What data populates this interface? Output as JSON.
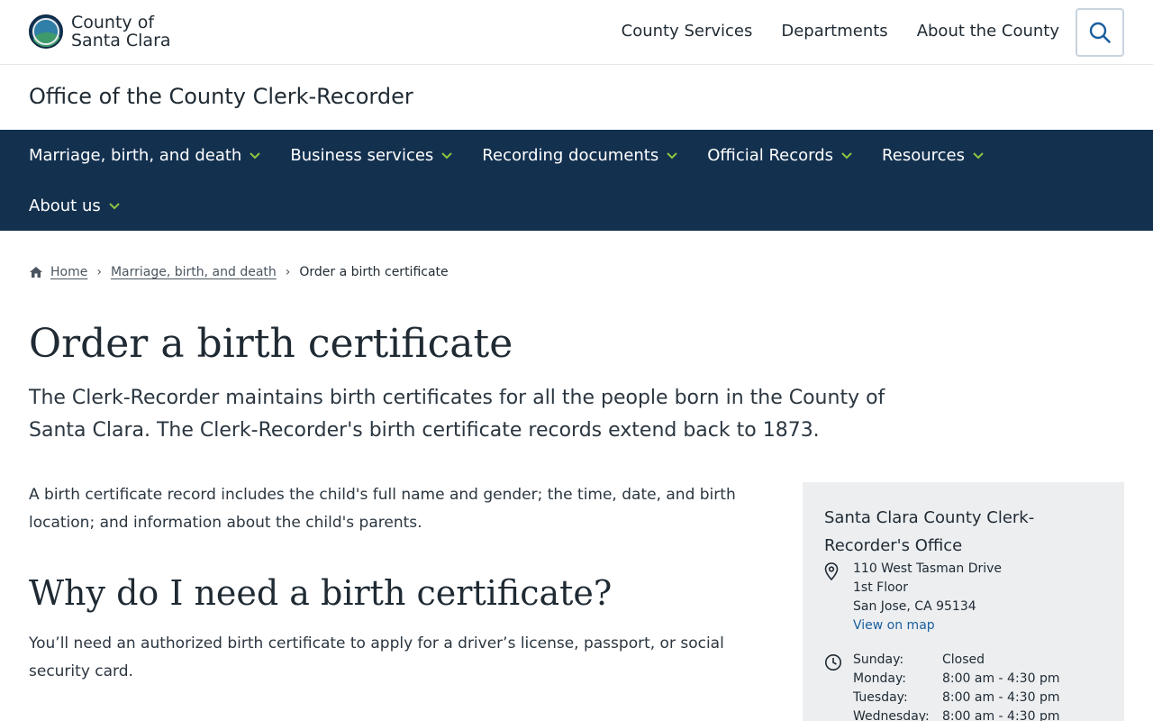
{
  "header": {
    "logo_line1": "County of",
    "logo_line2": "Santa Clara",
    "nav": [
      "County Services",
      "Departments",
      "About the County"
    ],
    "search_icon": "search-icon"
  },
  "department": "Office of the County Clerk-Recorder",
  "main_nav": {
    "row1": [
      "Marriage, birth, and death",
      "Business services",
      "Recording documents",
      "Official Records",
      "Resources"
    ],
    "row2": [
      "About us"
    ],
    "accent_color": "#8dc63f",
    "background": "#13304f"
  },
  "breadcrumb": {
    "home": "Home",
    "section": "Marriage, birth, and death",
    "current": "Order a birth certificate"
  },
  "page": {
    "title": "Order a birth certificate",
    "lead": "The Clerk-Recorder maintains birth certificates for all the people born in the County of Santa Clara. The Clerk-Recorder's birth certificate records extend back to 1873.",
    "para1": "A birth certificate record includes the child's full name and gender; the time, date, and birth location; and information about the child's parents.",
    "h2": "Why do I need a birth certificate?",
    "para2": "You’ll need an authorized birth certificate to apply for a driver’s license, passport, or social security card."
  },
  "contact_card": {
    "title": "Santa Clara County Clerk-Recorder's Office",
    "address_line1": "110 West Tasman Drive",
    "address_line2": "1st Floor",
    "address_line3": "San Jose, CA 95134",
    "map_link": "View on map",
    "hours": [
      {
        "day": "Sunday:",
        "time": "Closed"
      },
      {
        "day": "Monday:",
        "time": "8:00 am - 4:30 pm"
      },
      {
        "day": "Tuesday:",
        "time": "8:00 am - 4:30 pm"
      },
      {
        "day": "Wednesday:",
        "time": "8:00 am - 4:30 pm"
      }
    ]
  }
}
